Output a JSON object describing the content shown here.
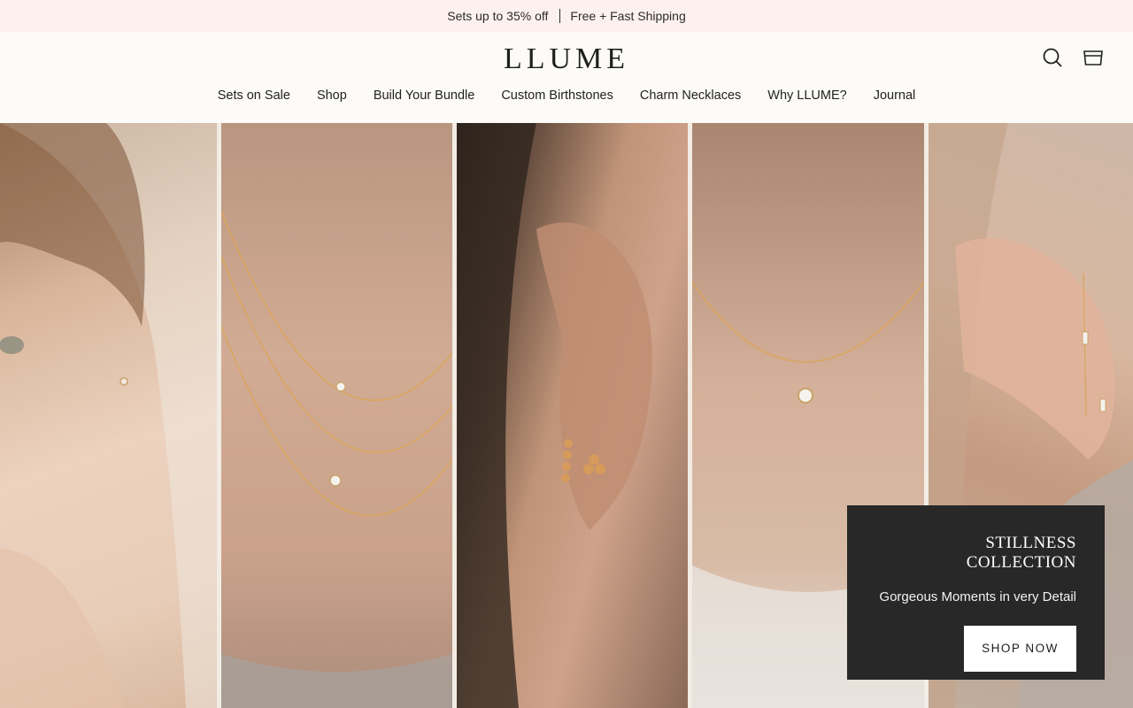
{
  "announcement": {
    "left": "Sets up to 35% off",
    "right": "Free + Fast Shipping"
  },
  "header": {
    "logo": "LLUME",
    "icons": [
      "search-icon",
      "cart-icon"
    ]
  },
  "nav": {
    "items": [
      {
        "label": "Sets on Sale"
      },
      {
        "label": "Shop"
      },
      {
        "label": "Build Your Bundle"
      },
      {
        "label": "Custom Birthstones"
      },
      {
        "label": "Charm Necklaces"
      },
      {
        "label": "Why LLUME?"
      },
      {
        "label": "Journal"
      }
    ]
  },
  "hero": {
    "promo": {
      "title": "STILLNESS COLLECTION",
      "subtitle": "Gorgeous Moments in very Detail",
      "button": "SHOP NOW"
    }
  },
  "colors": {
    "announcement_bg": "#fdf1ef",
    "header_bg": "#fdfbf8",
    "promo_bg": "#282828",
    "button_bg": "#ffffff"
  }
}
